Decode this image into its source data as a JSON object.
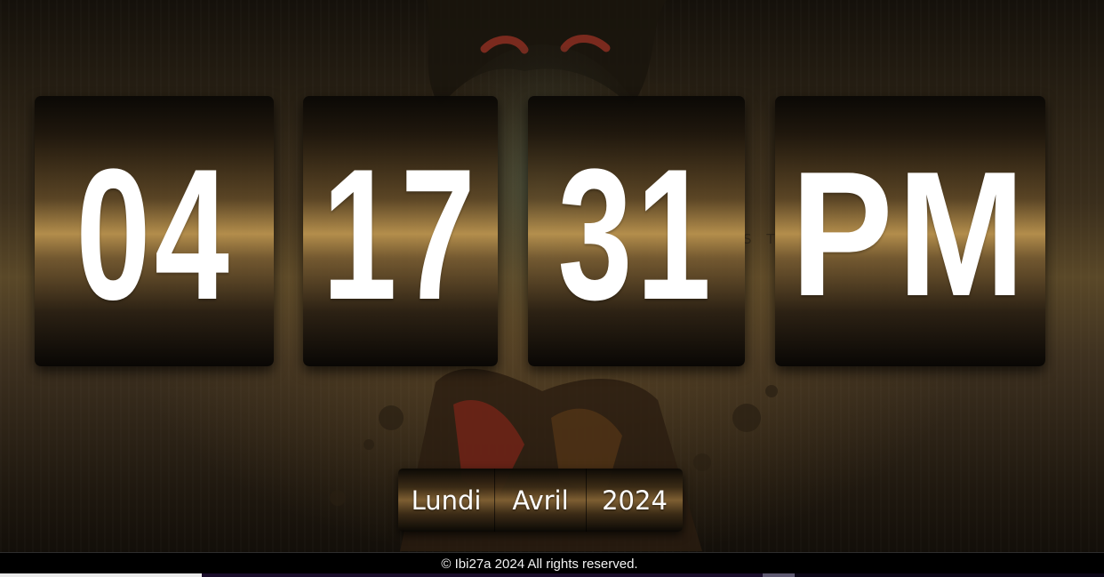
{
  "clock": {
    "hours": "04",
    "minutes": "17",
    "seconds": "31",
    "ampm": "PM"
  },
  "date": {
    "day": "Lundi",
    "month": "Avril",
    "year": "2024"
  },
  "footer": {
    "copyright": "© Ibi27a 2024 All rights reserved."
  },
  "colors": {
    "text": "#ffffff",
    "gold_band": "#be9650",
    "card_dark": "#0a0805",
    "footer_bg": "#000000"
  }
}
